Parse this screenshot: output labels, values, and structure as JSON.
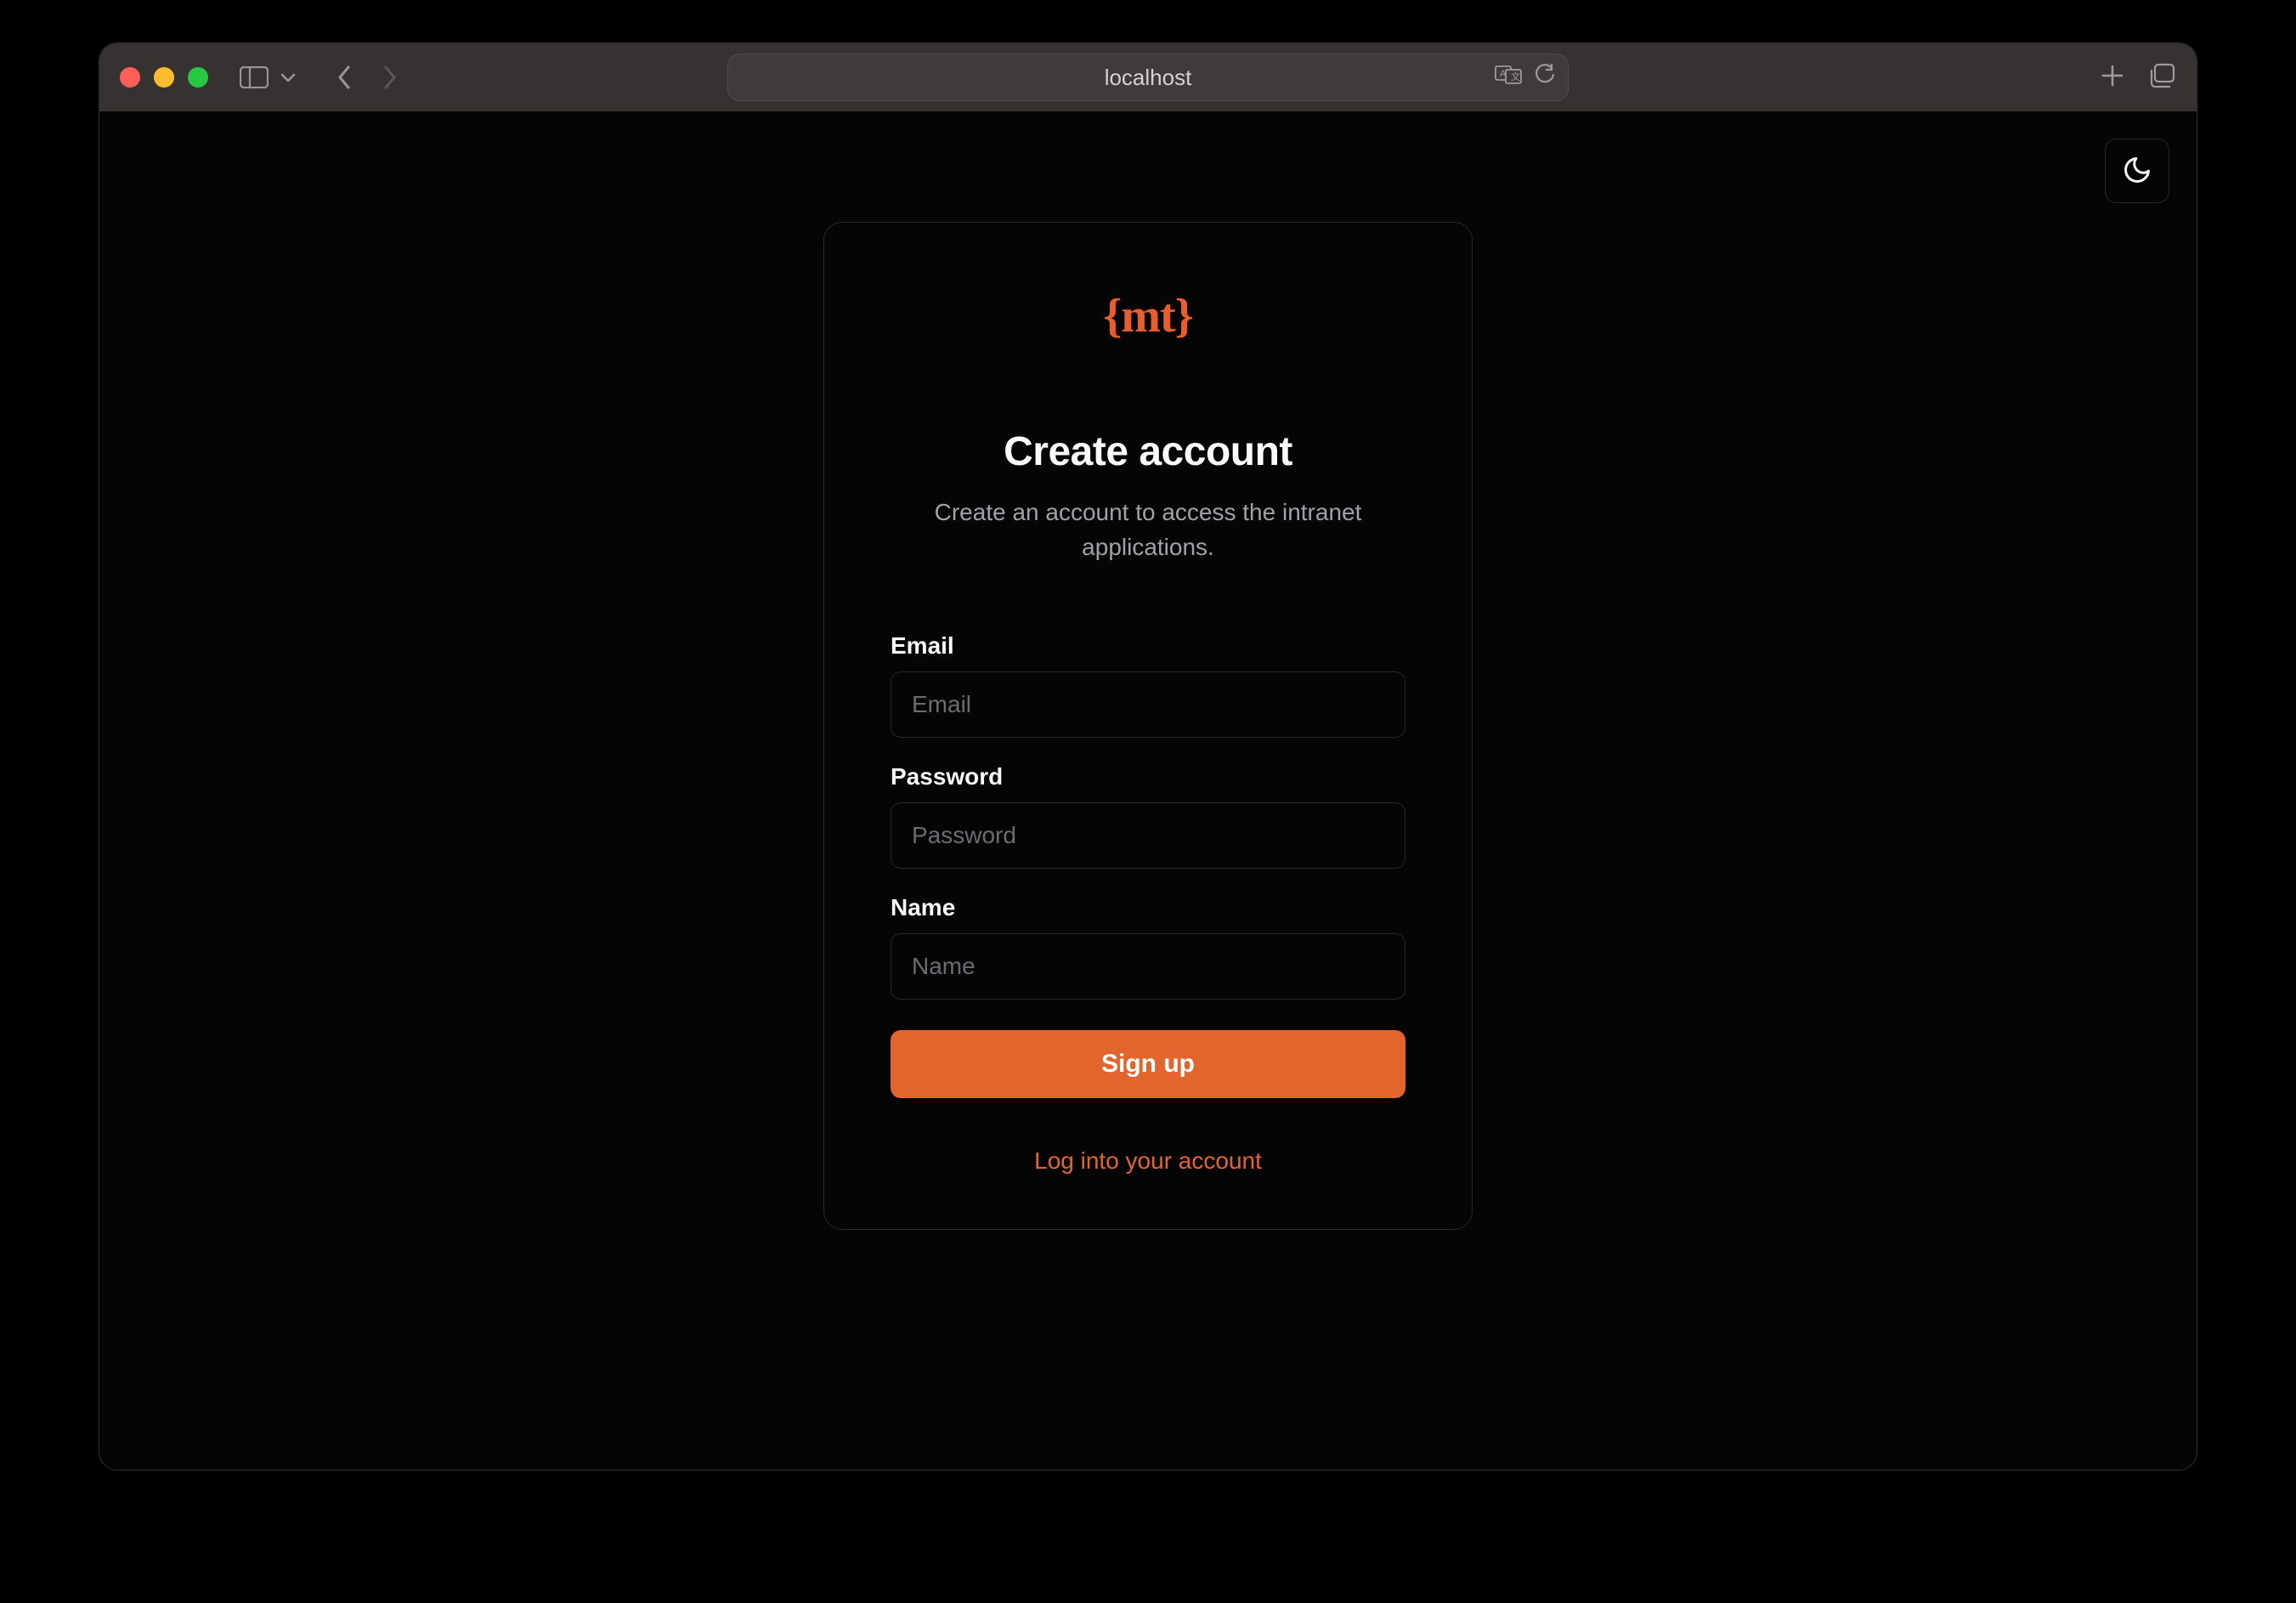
{
  "browser": {
    "address": "localhost"
  },
  "page": {
    "logo_text": "{mt}",
    "title": "Create account",
    "subtitle": "Create an account to access the intranet applications.",
    "fields": {
      "email": {
        "label": "Email",
        "placeholder": "Email",
        "value": ""
      },
      "password": {
        "label": "Password",
        "placeholder": "Password",
        "value": ""
      },
      "name": {
        "label": "Name",
        "placeholder": "Name",
        "value": ""
      }
    },
    "submit_label": "Sign up",
    "alt_link_label": "Log into your account"
  },
  "colors": {
    "accent": "#e1652d",
    "bg": "#050505",
    "border": "#27272a",
    "text_muted": "#a1a1aa"
  }
}
